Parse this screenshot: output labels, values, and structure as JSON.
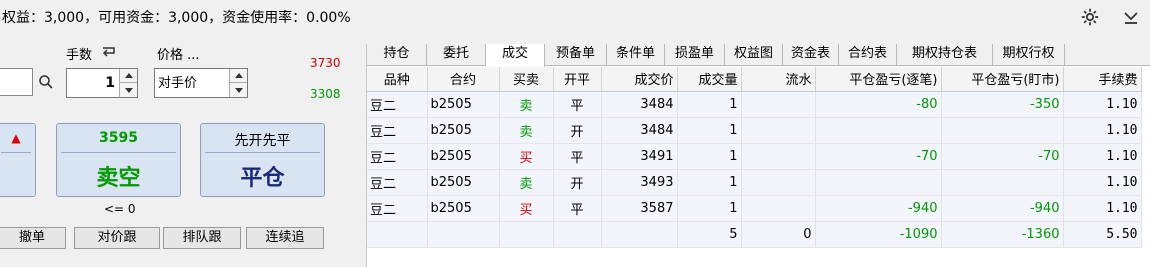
{
  "summary": {
    "text": "权益：3,000，可用资金：3,000，资金使用率：0.00%"
  },
  "order": {
    "qty_label": "手数",
    "qty_value": "1",
    "price_label": "价格 ...",
    "price_mode": "对手价",
    "ask_price": "3730",
    "bid_price": "3308",
    "buy_marker": "▲",
    "sell_price": "3595",
    "sell_label": "卖空",
    "close_top": "先开先平",
    "close_label": "平仓",
    "limit_note": "<= 0",
    "actions": [
      "撤单",
      "对价跟",
      "排队跟",
      "连续追"
    ]
  },
  "tabs": [
    "持仓",
    "委托",
    "成交",
    "预备单",
    "条件单",
    "损盈单",
    "权益图",
    "资金表",
    "合约表",
    "期权持仓表",
    "期权行权"
  ],
  "active_tab": "成交",
  "table": {
    "headers": [
      "品种",
      "合约",
      "买卖",
      "开平",
      "成交价",
      "成交量",
      "流水",
      "平仓盈亏(逐笔)",
      "平仓盈亏(盯市)",
      "手续费"
    ],
    "rows": [
      [
        "豆二",
        "b2505",
        "卖",
        "平",
        "3484",
        "1",
        "",
        "-80",
        "-350",
        "1.10"
      ],
      [
        "豆二",
        "b2505",
        "卖",
        "开",
        "3484",
        "1",
        "",
        "",
        "",
        "1.10"
      ],
      [
        "豆二",
        "b2505",
        "买",
        "平",
        "3491",
        "1",
        "",
        "-70",
        "-70",
        "1.10"
      ],
      [
        "豆二",
        "b2505",
        "卖",
        "开",
        "3493",
        "1",
        "",
        "",
        "",
        "1.10"
      ],
      [
        "豆二",
        "b2505",
        "买",
        "平",
        "3587",
        "1",
        "",
        "-940",
        "-940",
        "1.10"
      ]
    ],
    "total": [
      "",
      "",
      "",
      "",
      "",
      "5",
      "0",
      "-1090",
      "-1360",
      "5.50"
    ]
  },
  "colors": {
    "sell": "#009900",
    "buy": "#dd0000",
    "ask": "#cc0000",
    "bid": "#009900"
  }
}
